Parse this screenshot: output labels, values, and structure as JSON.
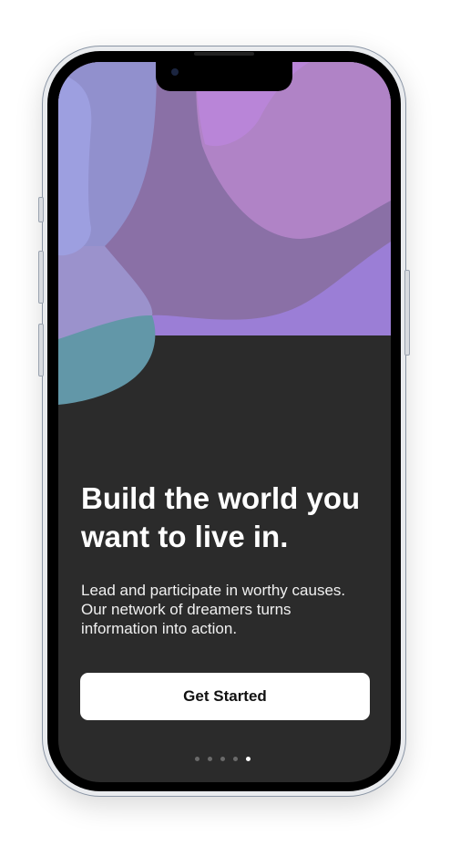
{
  "onboarding": {
    "headline": "Build the world you want to live in.",
    "description": "Lead and participate in worthy causes. Our network of dreamers turns information into action.",
    "cta_label": "Get Started",
    "pagination": {
      "total": 5,
      "current": 5
    }
  },
  "colors": {
    "background": "#2b2b2b",
    "button": "#ffffff",
    "blob_purple": "#8a70a6",
    "blob_pink": "#b083c6",
    "blob_teal": "#6297a8"
  }
}
